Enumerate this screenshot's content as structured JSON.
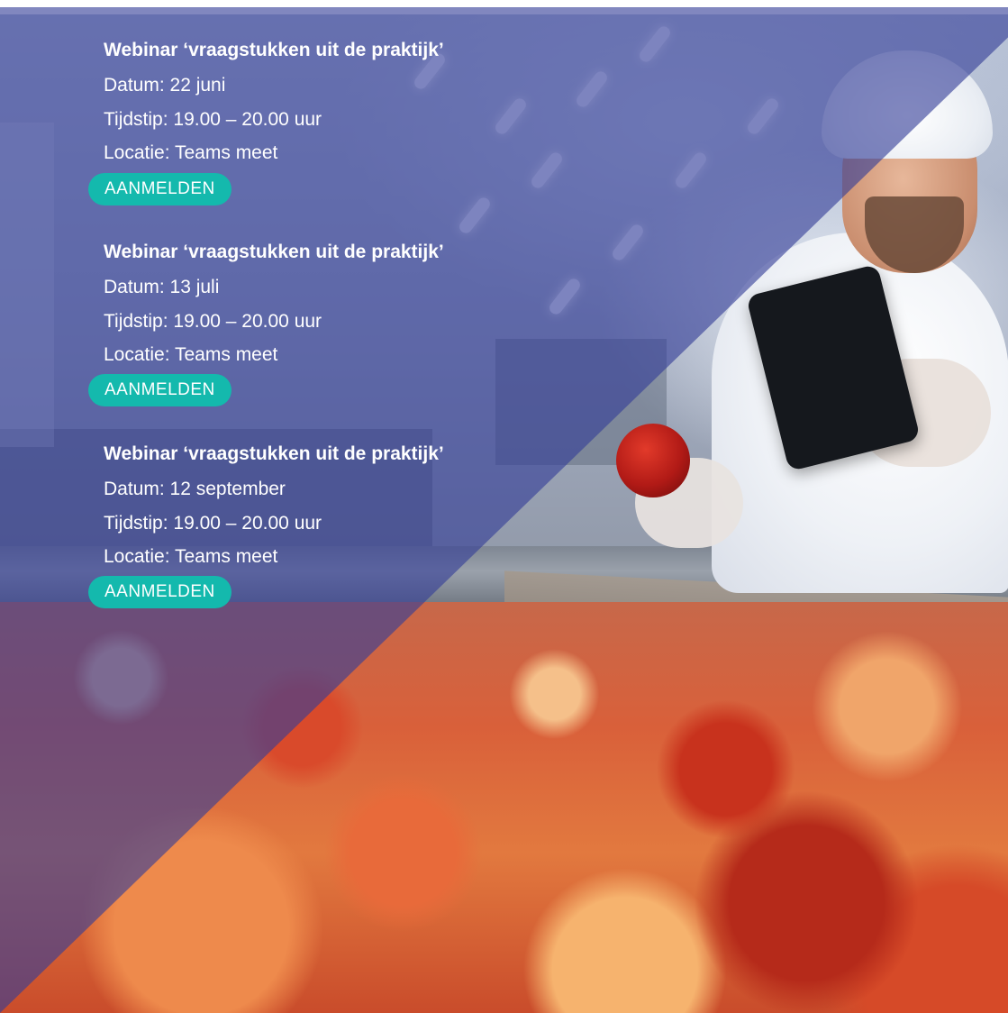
{
  "events": [
    {
      "title": "Webinar ‘vraagstukken uit de praktijk’",
      "date": "Datum: 22 juni",
      "time": "Tijdstip: 19.00 – 20.00 uur",
      "location": "Locatie: Teams meet",
      "button": "AANMELDEN"
    },
    {
      "title": "Webinar ‘vraagstukken uit de praktijk’",
      "date": "Datum: 13 juli",
      "time": "Tijdstip: 19.00 – 20.00 uur",
      "location": "Locatie: Teams meet",
      "button": "AANMELDEN"
    },
    {
      "title": "Webinar ‘vraagstukken uit de praktijk’",
      "date": "Datum: 12 september",
      "time": "Tijdstip: 19.00 – 20.00 uur",
      "location": "Locatie: Teams meet",
      "button": "AANMELDEN"
    }
  ],
  "colors": {
    "overlay": "#343e98",
    "button": "#14b9ad",
    "text": "#ffffff"
  },
  "background": {
    "icon": "photo-food-inspector-apples"
  }
}
